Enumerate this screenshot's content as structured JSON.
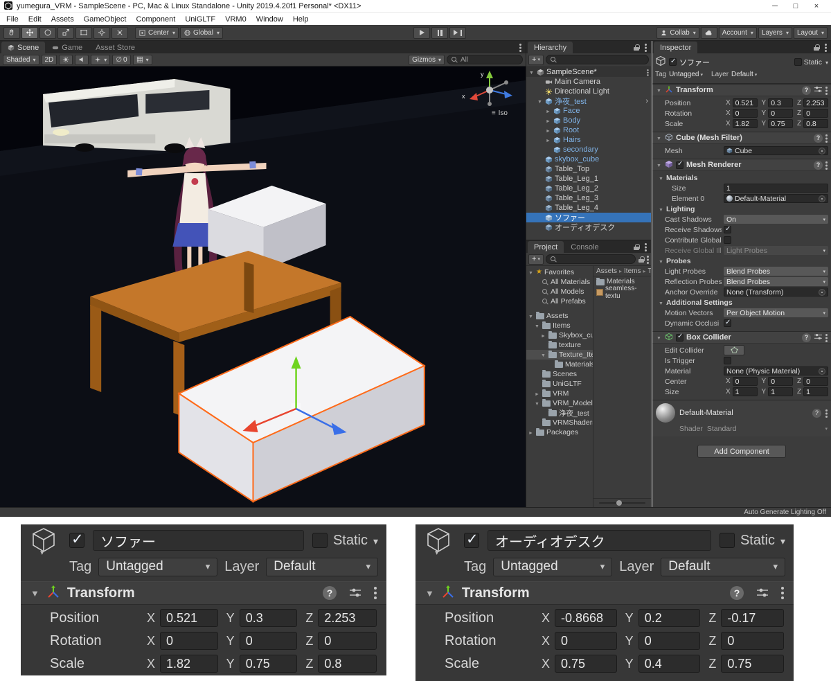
{
  "window": {
    "title": "yumegura_VRM - SampleScene - PC, Mac & Linux Standalone - Unity 2019.4.20f1 Personal* <DX11>",
    "minimize": "─",
    "maximize": "□",
    "close": "×"
  },
  "menubar": {
    "items": [
      "File",
      "Edit",
      "Assets",
      "GameObject",
      "Component",
      "UniGLTF",
      "VRM0",
      "Window",
      "Help"
    ]
  },
  "toolbar": {
    "pivot": "Center",
    "space": "Global",
    "collab": "Collab",
    "account": "Account",
    "layers": "Layers",
    "layout": "Layout"
  },
  "scene": {
    "tab_scene": "Scene",
    "tab_game": "Game",
    "tab_store": "Asset Store",
    "draw_mode": "Shaded",
    "mode_2d": "2D",
    "hidden_count": "0",
    "gizmos": "Gizmos",
    "search_value": "All",
    "gizmo_x": "x",
    "gizmo_y": "y",
    "projection": "Iso"
  },
  "hierarchy": {
    "tab": "Hierarchy",
    "items": [
      {
        "label": "SampleScene*"
      },
      {
        "label": "Main Camera"
      },
      {
        "label": "Directional Light"
      },
      {
        "label": "浄夜_test"
      },
      {
        "label": "Face"
      },
      {
        "label": "Body"
      },
      {
        "label": "Root"
      },
      {
        "label": "Hairs"
      },
      {
        "label": "secondary"
      },
      {
        "label": "skybox_cube"
      },
      {
        "label": "Table_Top"
      },
      {
        "label": "Table_Leg_1"
      },
      {
        "label": "Table_Leg_2"
      },
      {
        "label": "Table_Leg_3"
      },
      {
        "label": "Table_Leg_4"
      },
      {
        "label": "ソファー"
      },
      {
        "label": "オーディオデスク"
      }
    ]
  },
  "project": {
    "tab_project": "Project",
    "tab_console": "Console",
    "tree": [
      {
        "label": "Favorites"
      },
      {
        "label": "All Materials"
      },
      {
        "label": "All Models"
      },
      {
        "label": "All Prefabs"
      },
      {
        "label": "Assets"
      },
      {
        "label": "Items"
      },
      {
        "label": "Skybox_cub"
      },
      {
        "label": "texture"
      },
      {
        "label": "Texture_Item"
      },
      {
        "label": "Materials"
      },
      {
        "label": "Scenes"
      },
      {
        "label": "UniGLTF"
      },
      {
        "label": "VRM"
      },
      {
        "label": "VRM_Model"
      },
      {
        "label": "浄夜_test"
      },
      {
        "label": "VRMShaders"
      },
      {
        "label": "Packages"
      }
    ],
    "crumb_1": "Assets",
    "crumb_2": "Items",
    "crumb_3": "T...",
    "content": [
      {
        "label": "Materials"
      },
      {
        "label": "seamless-textu"
      }
    ]
  },
  "inspector": {
    "tab": "Inspector",
    "name": "ソファー",
    "static_label": "Static",
    "tag_label": "Tag",
    "tag_value": "Untagged",
    "layer_label": "Layer",
    "layer_value": "Default",
    "transform": {
      "title": "Transform",
      "rows": [
        {
          "label": "Position",
          "x": "0.521",
          "y": "0.3",
          "z": "2.253"
        },
        {
          "label": "Rotation",
          "x": "0",
          "y": "0",
          "z": "0"
        },
        {
          "label": "Scale",
          "x": "1.82",
          "y": "0.75",
          "z": "0.8"
        }
      ]
    },
    "mesh_filter": {
      "title": "Cube (Mesh Filter)",
      "mesh_label": "Mesh",
      "mesh_value": "Cube"
    },
    "mesh_renderer": {
      "title": "Mesh Renderer",
      "materials_title": "Materials",
      "size_label": "Size",
      "size_value": "1",
      "element_label": "Element 0",
      "element_value": "Default-Material",
      "lighting_title": "Lighting",
      "cast_label": "Cast Shadows",
      "cast_value": "On",
      "receive_label": "Receive Shadows",
      "contribute_label": "Contribute Global",
      "rgi_label": "Receive Global Ill",
      "rgi_value": "Light Probes",
      "probes_title": "Probes",
      "light_probes_label": "Light Probes",
      "light_probes_value": "Blend Probes",
      "reflection_label": "Reflection Probes",
      "reflection_value": "Blend Probes",
      "anchor_label": "Anchor Override",
      "anchor_value": "None (Transform)",
      "additional_title": "Additional Settings",
      "motion_label": "Motion Vectors",
      "motion_value": "Per Object Motion",
      "occlusion_label": "Dynamic Occlusi"
    },
    "box_collider": {
      "title": "Box Collider",
      "edit_label": "Edit Collider",
      "trigger_label": "Is Trigger",
      "material_label": "Material",
      "material_value": "None (Physic Material)",
      "center_label": "Center",
      "center": {
        "x": "0",
        "y": "0",
        "z": "0"
      },
      "size_label": "Size",
      "size": {
        "x": "1",
        "y": "1",
        "z": "1"
      }
    },
    "material": {
      "name": "Default-Material",
      "shader_label": "Shader",
      "shader_value": "Standard"
    },
    "add_component": "Add Component"
  },
  "axis": {
    "x": "X",
    "y": "Y",
    "z": "Z"
  },
  "status": {
    "lighting": "Auto Generate Lighting Off"
  },
  "zoom": {
    "left": {
      "name": "ソファー",
      "static_label": "Static",
      "tag_label": "Tag",
      "tag_value": "Untagged",
      "layer_label": "Layer",
      "layer_value": "Default",
      "component": "Transform",
      "rows": [
        {
          "label": "Position",
          "x": "0.521",
          "y": "0.3",
          "z": "2.253"
        },
        {
          "label": "Rotation",
          "x": "0",
          "y": "0",
          "z": "0"
        },
        {
          "label": "Scale",
          "x": "1.82",
          "y": "0.75",
          "z": "0.8"
        }
      ]
    },
    "right": {
      "name": "オーディオデスク",
      "static_label": "Static",
      "tag_label": "Tag",
      "tag_value": "Untagged",
      "layer_label": "Layer",
      "layer_value": "Default",
      "component": "Transform",
      "rows": [
        {
          "label": "Position",
          "x": "-0.8668",
          "y": "0.2",
          "z": "-0.17"
        },
        {
          "label": "Rotation",
          "x": "0",
          "y": "0",
          "z": "0"
        },
        {
          "label": "Scale",
          "x": "0.75",
          "y": "0.4",
          "z": "0.75"
        }
      ]
    }
  }
}
